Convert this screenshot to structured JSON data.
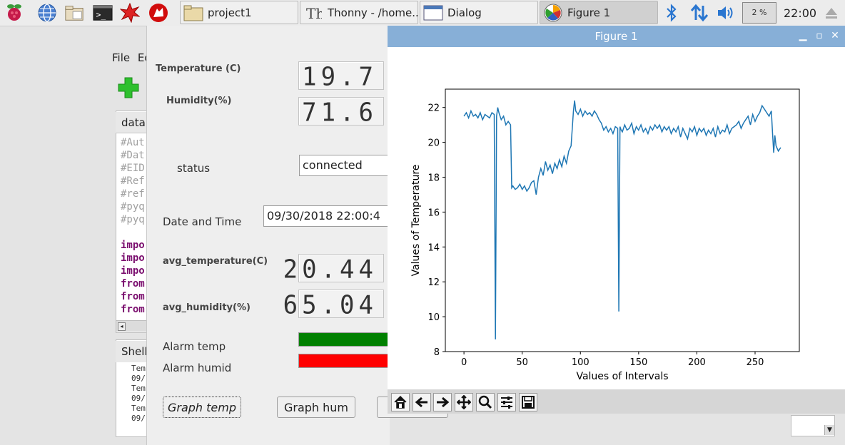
{
  "taskbar": {
    "launchers": [
      {
        "icon": "raspberry-menu-icon"
      },
      {
        "icon": "web-browser-icon"
      },
      {
        "icon": "file-manager-icon"
      },
      {
        "icon": "terminal-icon"
      },
      {
        "icon": "mathematica-icon"
      },
      {
        "icon": "wolfram-icon"
      }
    ],
    "tasks": [
      {
        "label": "project1",
        "icon": "folder-icon"
      },
      {
        "label": "Thonny  -  /home...",
        "icon": "thonny-icon"
      },
      {
        "label": "Dialog",
        "icon": "window-icon"
      },
      {
        "label": "Figure 1",
        "icon": "matplotlib-icon"
      }
    ],
    "cpu": "2 %",
    "clock": "22:00"
  },
  "thonny": {
    "menu_file": "File",
    "menu_edit": "Ed",
    "editor_tab": "data.",
    "code_lines": [
      {
        "text": "#Aut",
        "kind": "comment"
      },
      {
        "text": "#Dat",
        "kind": "comment"
      },
      {
        "text": "#EID",
        "kind": "comment"
      },
      {
        "text": "#Ref",
        "kind": "comment"
      },
      {
        "text": "#ref",
        "kind": "comment"
      },
      {
        "text": "#pyq",
        "kind": "comment"
      },
      {
        "text": "#pyq",
        "kind": "comment"
      },
      {
        "text": "",
        "kind": "blank"
      },
      {
        "text": "impo",
        "kind": "kw"
      },
      {
        "text": "impo",
        "kind": "kw"
      },
      {
        "text": "impo",
        "kind": "kw"
      },
      {
        "text": "from",
        "kind": "kw"
      },
      {
        "text": "from",
        "kind": "kw"
      },
      {
        "text": "from",
        "kind": "kw"
      }
    ],
    "shell_tab": "Shell",
    "shell_lines": [
      "Tem",
      "09/",
      "Tem",
      "09/",
      "Tem",
      "09/"
    ]
  },
  "dialog": {
    "temp_label": "Temperature (C)",
    "temp_value": "19.7",
    "hum_label": "Humidity(%)",
    "hum_value": "71.6",
    "status_label": "status",
    "status_value": "connected",
    "datetime_label": "Date and Time",
    "datetime_value": "09/30/2018 22:00:4",
    "avg_temp_label": "avg_temperature(C)",
    "avg_temp_value": "20.44",
    "avg_hum_label": "avg_humidity(%)",
    "avg_hum_value": "65.04",
    "alarm_temp_label": "Alarm temp",
    "alarm_temp_color": "#008000",
    "alarm_hum_label": "Alarm humid",
    "alarm_hum_color": "#ff0000",
    "graph_temp_button": "Graph temp",
    "graph_hum_button": "Graph hum"
  },
  "figure": {
    "title": "Figure 1",
    "toolbar": [
      "home-icon",
      "back-icon",
      "forward-icon",
      "pan-icon",
      "zoom-icon",
      "configure-subplots-icon",
      "save-icon"
    ]
  },
  "chart_data": {
    "type": "line",
    "title": "",
    "xlabel": "Values of Intervals",
    "ylabel": "Values of Temperature",
    "xlim": [
      -16,
      288
    ],
    "ylim": [
      8,
      23.05
    ],
    "xticks": [
      0,
      50,
      100,
      150,
      200,
      250
    ],
    "yticks": [
      8,
      10,
      12,
      14,
      16,
      18,
      20,
      22
    ],
    "grid": false,
    "line_color": "#1f77b4",
    "x": [
      0,
      2,
      4,
      6,
      8,
      10,
      12,
      14,
      16,
      18,
      20,
      22,
      24,
      26,
      27,
      28,
      29,
      30,
      32,
      34,
      36,
      38,
      40,
      41,
      42,
      44,
      46,
      48,
      50,
      52,
      54,
      56,
      58,
      60,
      62,
      64,
      66,
      68,
      70,
      72,
      74,
      76,
      78,
      80,
      82,
      84,
      86,
      88,
      90,
      92,
      94,
      95,
      96,
      98,
      100,
      102,
      104,
      106,
      108,
      110,
      112,
      114,
      116,
      118,
      120,
      122,
      124,
      126,
      128,
      130,
      132,
      133,
      134,
      135,
      136,
      138,
      140,
      142,
      144,
      146,
      148,
      150,
      152,
      154,
      156,
      158,
      160,
      162,
      164,
      166,
      168,
      170,
      172,
      174,
      176,
      178,
      180,
      182,
      184,
      186,
      188,
      190,
      192,
      194,
      196,
      198,
      200,
      202,
      204,
      206,
      208,
      210,
      212,
      214,
      216,
      218,
      220,
      222,
      224,
      226,
      228,
      230,
      232,
      234,
      236,
      238,
      240,
      242,
      244,
      246,
      248,
      250,
      252,
      254,
      256,
      258,
      260,
      262,
      264,
      265,
      266,
      267,
      268,
      270,
      272
    ],
    "y": [
      21.5,
      21.7,
      21.4,
      21.8,
      21.5,
      21.6,
      21.4,
      21.7,
      21.3,
      21.6,
      21.5,
      21.4,
      21.7,
      21.6,
      8.7,
      21.5,
      22.0,
      21.7,
      21.3,
      21.5,
      21.0,
      21.2,
      21.0,
      17.4,
      17.5,
      17.3,
      17.4,
      17.6,
      17.3,
      17.5,
      17.2,
      17.4,
      17.7,
      17.8,
      17.0,
      18.0,
      18.5,
      18.1,
      18.9,
      18.4,
      18.7,
      18.2,
      18.8,
      18.5,
      19.0,
      18.6,
      19.2,
      18.8,
      19.5,
      19.8,
      21.8,
      22.4,
      21.8,
      21.6,
      21.9,
      21.5,
      21.8,
      21.6,
      21.7,
      21.5,
      21.8,
      21.6,
      21.3,
      21.1,
      20.7,
      20.9,
      20.6,
      20.8,
      20.5,
      20.9,
      20.8,
      10.3,
      20.9,
      20.7,
      20.6,
      21.0,
      20.7,
      20.8,
      21.1,
      20.5,
      20.9,
      20.7,
      21.0,
      20.6,
      20.8,
      20.5,
      20.9,
      20.7,
      21.0,
      20.8,
      21.0,
      20.6,
      20.9,
      20.7,
      20.9,
      20.5,
      20.8,
      20.6,
      20.9,
      20.3,
      20.8,
      20.5,
      20.2,
      20.8,
      20.6,
      20.9,
      20.4,
      20.8,
      20.6,
      20.8,
      20.4,
      20.7,
      20.5,
      20.8,
      20.3,
      20.9,
      20.5,
      20.7,
      20.6,
      21.0,
      20.5,
      20.8,
      20.9,
      21.0,
      21.2,
      20.8,
      21.1,
      21.3,
      21.5,
      21.0,
      21.6,
      21.2,
      21.5,
      21.7,
      22.1,
      21.9,
      21.7,
      21.5,
      21.8,
      20.5,
      19.4,
      20.4,
      19.8,
      19.5,
      19.7
    ]
  }
}
